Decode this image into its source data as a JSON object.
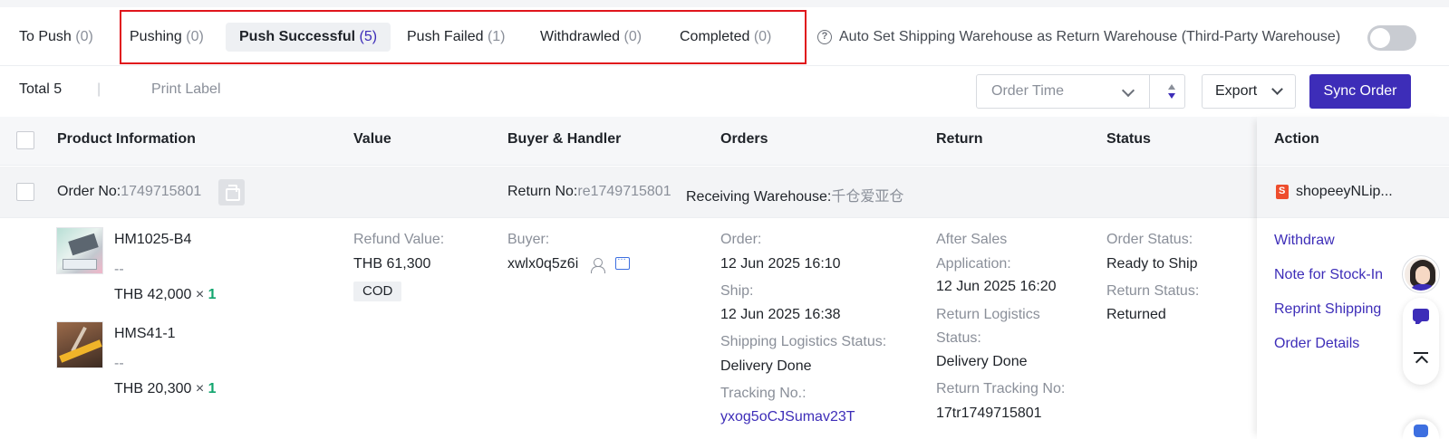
{
  "tabs": [
    {
      "label": "To Push",
      "count": "(0)"
    },
    {
      "label": "Pushing",
      "count": "(0)"
    },
    {
      "label": "Push Successful",
      "count": "(5)"
    },
    {
      "label": "Push Failed",
      "count": "(1)"
    },
    {
      "label": "Withdrawled",
      "count": "(0)"
    },
    {
      "label": "Completed",
      "count": "(0)"
    }
  ],
  "active_tab": "Push Successful",
  "auto_set": {
    "label": "Auto Set Shipping Warehouse as Return Warehouse (Third-Party Warehouse)",
    "enabled": false
  },
  "help_glyph": "?",
  "toolbar": {
    "total": "Total 5",
    "separator": "|",
    "print_label": "Print Label",
    "sort_placeholder": "Order Time",
    "export_label": "Export",
    "sync_label": "Sync Order"
  },
  "columns": {
    "product": "Product Information",
    "value": "Value",
    "buyer": "Buyer & Handler",
    "orders": "Orders",
    "return": "Return",
    "status": "Status",
    "action": "Action"
  },
  "order": {
    "order_no_label": "Order No:",
    "order_no": "1749715801",
    "return_no_label": "Return No:",
    "return_no": "re1749715801",
    "warehouse_label": "Receiving Warehouse:",
    "warehouse": "千仓爱亚仓",
    "shop": "shopeeyNLip...",
    "products": [
      {
        "sku": "HM1025-B4",
        "variant": "--",
        "price": "THB 42,000",
        "times": "×",
        "qty": "1"
      },
      {
        "sku": "HMS41-1",
        "variant": "--",
        "price": "THB 20,300",
        "times": "×",
        "qty": "1"
      }
    ],
    "value": {
      "refund_label": "Refund Value:",
      "refund": "THB 61,300",
      "payment": "COD"
    },
    "buyer": {
      "label": "Buyer:",
      "name": "xwlx0q5z6i"
    },
    "orders": {
      "order_label": "Order:",
      "order_time": "12 Jun 2025 16:10",
      "ship_label": "Ship:",
      "ship_time": "12 Jun 2025 16:38",
      "logistics_label": "Shipping Logistics Status:",
      "logistics": "Delivery Done",
      "tracking_label": "Tracking No.:",
      "tracking": "yxog5oCJSumav23T"
    },
    "return": {
      "after_sales_label_1": "After Sales",
      "after_sales_label_2": "Application:",
      "after_sales_time": "12 Jun 2025 16:20",
      "logistics_label_1": "Return Logistics",
      "logistics_label_2": "Status:",
      "logistics": "Delivery Done",
      "tracking_label": "Return Tracking No:",
      "tracking": "17tr1749715801"
    },
    "status": {
      "order_label": "Order Status:",
      "order": "Ready to Ship",
      "return_label": "Return Status:",
      "return": "Returned"
    },
    "actions": [
      "Withdraw",
      "Note for Stock-In",
      "Reprint Shipping",
      "Order Details"
    ]
  },
  "colors": {
    "accent": "#3d2db8",
    "highlight_border": "#e0151c",
    "quantity": "#12a56e",
    "shop_brand": "#ee4d2d"
  },
  "icons": [
    "help-circle-icon",
    "toggle-switch",
    "chevron-down-icon",
    "sort-icon",
    "copy-icon",
    "buyer-profile-icon",
    "chat-icon",
    "shop-icon",
    "support-avatar",
    "feedback-icon",
    "back-to-top-icon"
  ]
}
